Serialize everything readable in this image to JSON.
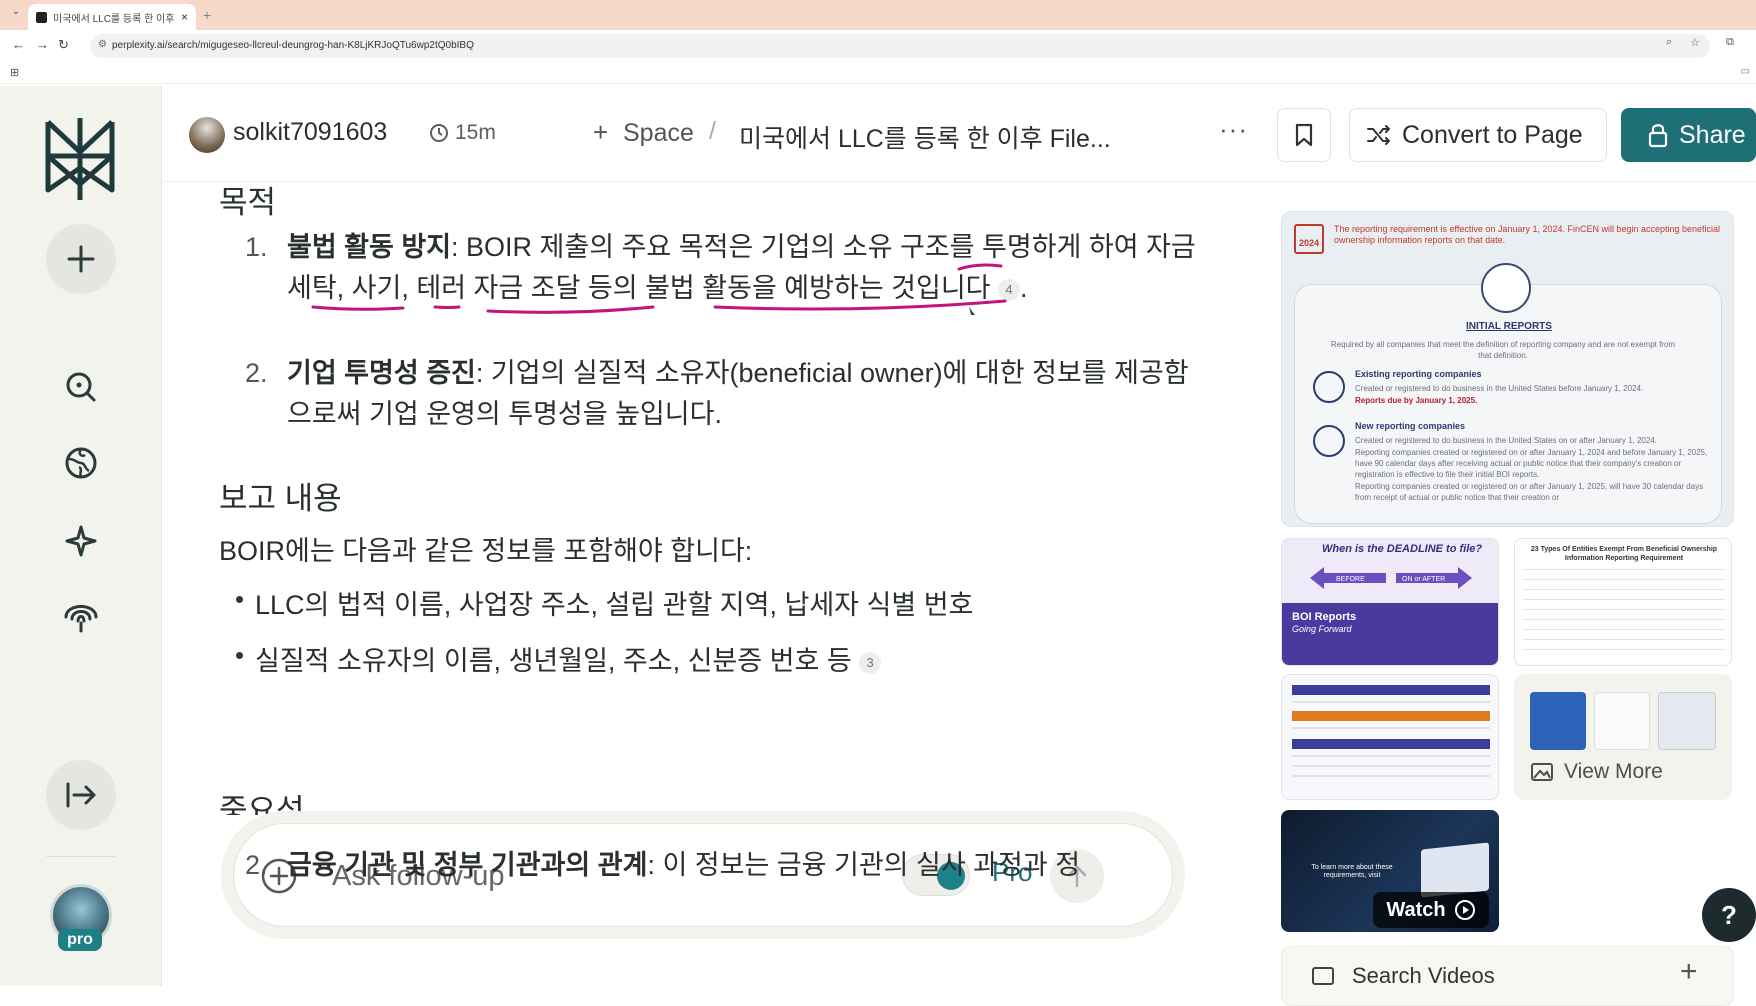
{
  "browser": {
    "tab_title": "미국에서 LLC를 등록 한 이후 F",
    "tab_close": "×",
    "new_tab": "+",
    "url": "perplexity.ai/search/migugeseo-llcreul-deungrog-han-K8LjKRJoQTu6wp2tQ0bIBQ"
  },
  "header": {
    "username": "solkit7091603",
    "time_ago": "15m",
    "space_label": "Space",
    "crumb_sep": "/",
    "thread_title": "미국에서 LLC를 등록 한 이후 File...",
    "more": "···",
    "convert_label": "Convert to Page",
    "share_label": "Share"
  },
  "sidebar": {
    "pro_badge": "pro"
  },
  "answer": {
    "section_purpose": "목적",
    "items": [
      {
        "num": "1.",
        "bold": "불법 활동 방지",
        "text": ": BOIR 제출의 주요 목적은 기업의 소유 구조를 투명하게 하여 자금 세탁, 사기, 테러 자금 조달 등의 불법 활동을 예방하는 것입니다",
        "cite": "4",
        "tail": "."
      },
      {
        "num": "2.",
        "bold": "기업 투명성 증진",
        "text": ": 기업의 실질적 소유자(beneficial owner)에 대한 정보를 제공함으로써 기업 운영의 투명성을 높입니다."
      }
    ],
    "section_report": "보고 내용",
    "report_intro": "BOIR에는 다음과 같은 정보를 포함해야 합니다:",
    "bullets": [
      {
        "text": "LLC의 법적 이름, 사업장 주소, 설립 관할 지역, 납세자 식별 번호"
      },
      {
        "text": "실질적 소유자의 이름, 생년월일, 주소, 신분증 번호 등",
        "cite": "3"
      }
    ],
    "section_importance": "중요성",
    "item_bottom": {
      "num": "2.",
      "bold": "금융 기관 및 정부 기관과의 관계",
      "text": ": 이 정보는 금융 기관의 실사 과정과 정"
    }
  },
  "followup": {
    "placeholder": "Ask follow-up",
    "pro_label": "Pro",
    "pro_enabled": true
  },
  "media": {
    "hero": {
      "calendar_year": "2024",
      "top_text": "The reporting requirement is effective on January 1, 2024. FinCEN will begin accepting beneficial ownership information reports on that date.",
      "title": "INITIAL REPORTS",
      "intro": "Required by all companies that meet the definition of reporting company and are not exempt from that definition.",
      "existing_title": "Existing reporting companies",
      "existing_text": "Created or registered to do business in the United States before January 1, 2024.",
      "existing_due": "Reports due by January 1, 2025.",
      "new_title": "New reporting companies",
      "new_text1": "Created or registered to do business in the United States on or after January 1, 2024.",
      "new_text2": "Reporting companies created or registered on or after January 1, 2024 and before January 1, 2025, have 90 calendar days after receiving actual or public notice that their company's creation or registration is effective to file their initial BOI reports.",
      "new_text3": "Reporting companies created or registered on or after January 1, 2025, will have 30 calendar days from receipt of actual or public notice that their creation or"
    },
    "deadline_title": "When is the DEADLINE to file?",
    "deadline_boi": "BOI Reports",
    "deadline_sub": "Going Forward",
    "deadline_before": "BEFORE",
    "deadline_after": "ON or AFTER",
    "table_title": "23 Types Of Entities Exempt From Beneficial Ownership Information Reporting Requirement",
    "view_more": "View More",
    "video_text": "To learn more about these requirements, visit",
    "watch_label": "Watch",
    "search_videos": "Search Videos",
    "search_videos_plus": "+"
  },
  "help": "?"
}
